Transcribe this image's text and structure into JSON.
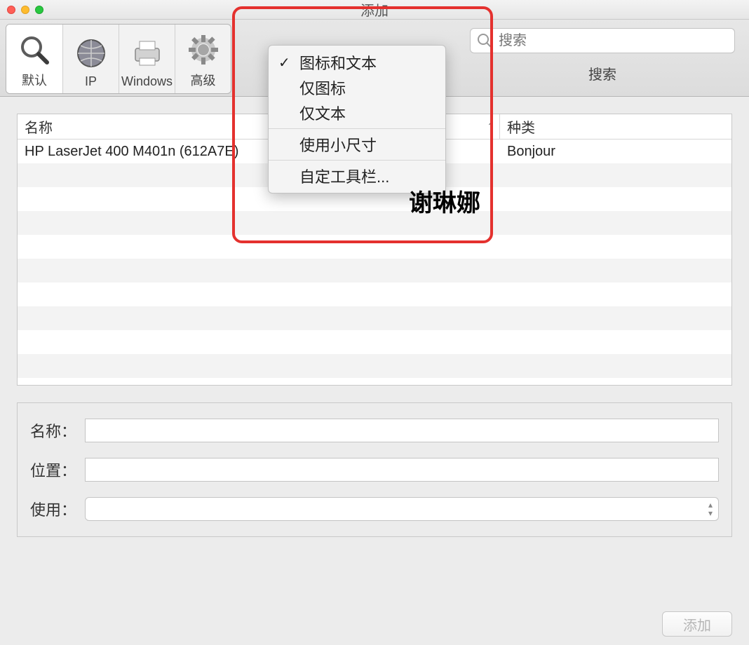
{
  "window": {
    "title": "添加"
  },
  "toolbar": {
    "items": [
      {
        "label": "默认"
      },
      {
        "label": "IP"
      },
      {
        "label": "Windows"
      },
      {
        "label": "高级"
      }
    ],
    "search": {
      "placeholder": "搜索",
      "label": "搜索"
    }
  },
  "list": {
    "columns": {
      "name": "名称",
      "kind": "种类"
    },
    "rows": [
      {
        "name": "HP LaserJet 400 M401n (612A7E)",
        "kind": "Bonjour"
      }
    ]
  },
  "form": {
    "name_label": "名称：",
    "location_label": "位置：",
    "use_label": "使用：",
    "name_value": "",
    "location_value": "",
    "use_value": ""
  },
  "footer": {
    "add_label": "添加"
  },
  "context_menu": {
    "icon_and_text": "图标和文本",
    "icon_only": "仅图标",
    "text_only": "仅文本",
    "small_size": "使用小尺寸",
    "customize": "自定工具栏..."
  },
  "annotation": {
    "author": "谢琳娜"
  }
}
